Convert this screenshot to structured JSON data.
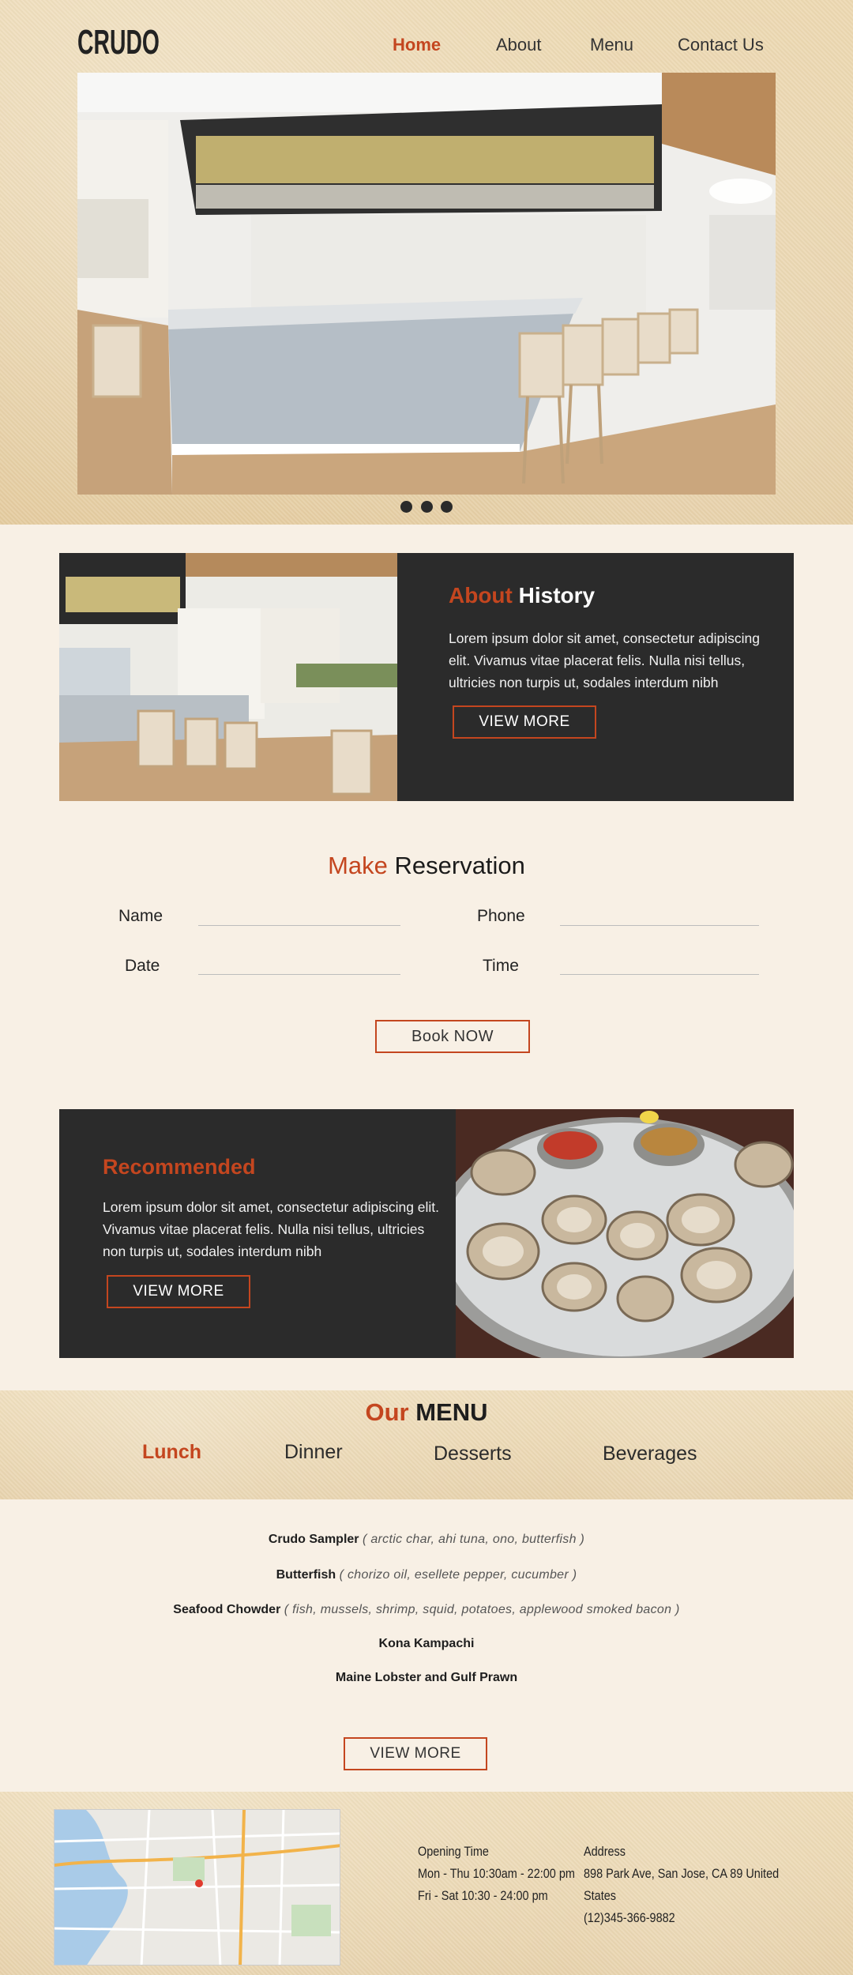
{
  "brand": {
    "logo_text": "CRUDO",
    "accent_color": "#c4461f",
    "dark_panel": "#2b2b2b"
  },
  "nav": {
    "items": [
      "Home",
      "About",
      "Menu",
      "Contact Us"
    ],
    "active": "Home"
  },
  "hero": {
    "slide_indicators": 3
  },
  "about": {
    "title_accent": "About",
    "title_rest": "History",
    "text": "Lorem ipsum dolor sit amet, consectetur adipiscing elit. Vivamus vitae placerat felis. Nulla nisi tellus, ultricies non turpis ut, sodales interdum nibh",
    "button": "VIEW MORE"
  },
  "reservation": {
    "title_accent": "Make",
    "title_rest": "Reservation",
    "name_label": "Name",
    "phone_label": "Phone",
    "date_label": "Date",
    "time_label": "Time",
    "button": "Book NOW"
  },
  "recommended": {
    "title": "Recommended",
    "text": "Lorem ipsum dolor sit amet, consectetur adipiscing elit. Vivamus vitae placerat felis. Nulla nisi tellus, ultricies non turpis ut, sodales interdum nibh",
    "button": "VIEW MORE"
  },
  "menu": {
    "title_accent": "Our",
    "title_rest": "MENU",
    "tabs": [
      "Lunch",
      "Dinner",
      "Desserts",
      "Beverages"
    ],
    "active_tab": "Lunch",
    "items": [
      {
        "name": "Crudo Sampler",
        "desc": "( arctic char, ahi tuna, ono, butterfish )"
      },
      {
        "name": "Butterfish",
        "desc": "( chorizo oil, esellete pepper, cucumber )"
      },
      {
        "name": "Seafood Chowder",
        "desc": "( fish, mussels, shrimp, squid, potatoes, applewood smoked bacon )"
      },
      {
        "name": "Kona Kampachi",
        "desc": ""
      },
      {
        "name": "Maine Lobster and Gulf Prawn",
        "desc": ""
      }
    ],
    "button": "VIEW MORE"
  },
  "footer": {
    "hours_title": "Opening Time",
    "hours_1": "Mon - Thu 10:30am - 22:00 pm",
    "hours_2": "Fri - Sat 10:30 - 24:00 pm",
    "address_title": "Address",
    "address_line": "898 Park Ave, San Jose, CA 89 United States",
    "phone": "(12)345-366-9882"
  }
}
